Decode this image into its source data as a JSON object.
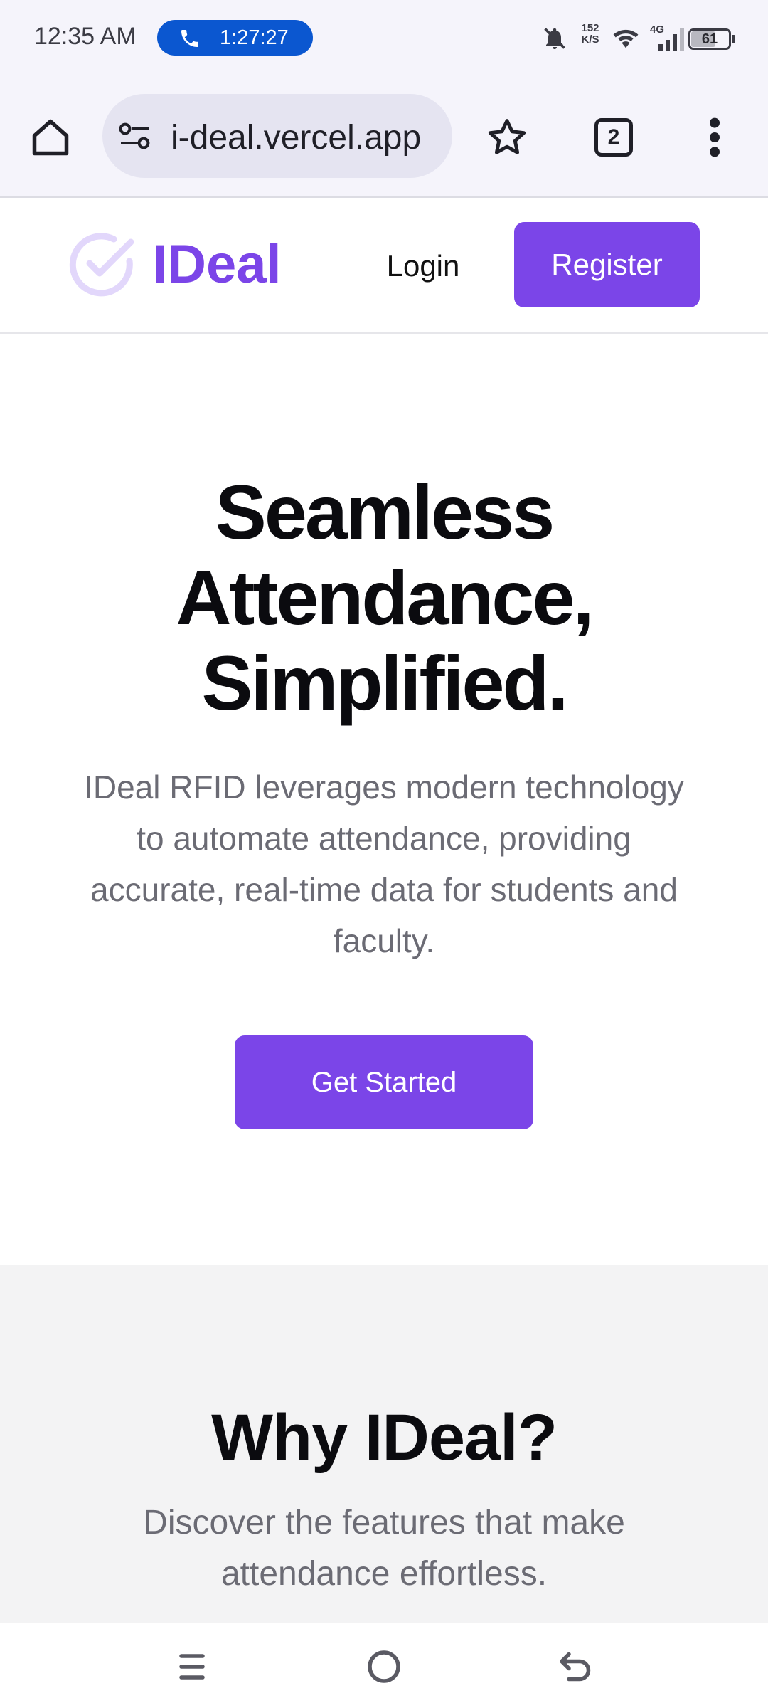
{
  "status_bar": {
    "time": "12:35 AM",
    "call_duration": "1:27:27",
    "net_speed_value": "152",
    "net_speed_unit": "K/S",
    "network": "4G",
    "battery": "61",
    "icons": [
      "phone-icon",
      "mute-bell-icon",
      "wifi-icon",
      "signal-icon",
      "battery-icon"
    ]
  },
  "browser": {
    "url": "i-deal.vercel.app",
    "tab_count": "2",
    "icons": [
      "home-icon",
      "site-settings-icon",
      "star-icon",
      "tabs-icon",
      "more-vert-icon"
    ]
  },
  "site_header": {
    "logo_text": "IDeal",
    "login_label": "Login",
    "register_label": "Register"
  },
  "hero": {
    "title_line1": "Seamless",
    "title_line2": "Attendance,",
    "title_line3": "Simplified.",
    "description": "IDeal RFID leverages modern technology to automate attendance, providing accurate, real-time data for students and faculty.",
    "cta_label": "Get Started"
  },
  "why": {
    "title": "Why IDeal?",
    "description": "Discover the features that make attendance effortless."
  },
  "nav_bar": {
    "icons": [
      "recents-icon",
      "home-circle-icon",
      "back-icon"
    ]
  },
  "colors": {
    "accent": "#7b45e8",
    "call_pill": "#0b57d0",
    "browser_bg": "#f5f4fb",
    "url_pill_bg": "#e5e4f1",
    "muted_text": "#6b6b74",
    "section_bg": "#f3f3f4"
  }
}
